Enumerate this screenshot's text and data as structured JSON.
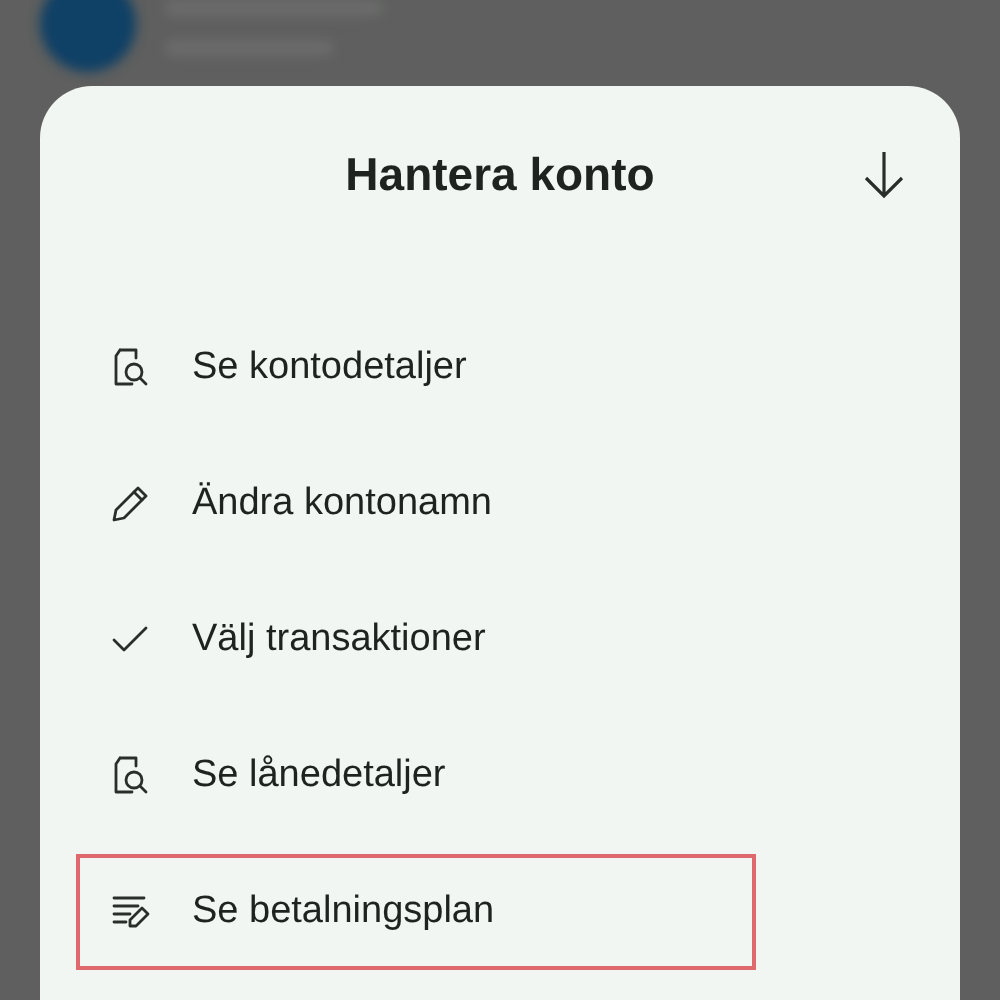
{
  "sheet": {
    "title": "Hantera konto",
    "items": [
      {
        "label": "Se kontodetaljer",
        "kind": "document",
        "selected": false
      },
      {
        "label": "Ändra kontonamn",
        "kind": "pencil",
        "selected": false
      },
      {
        "label": "Välj transaktioner",
        "kind": "check",
        "selected": false
      },
      {
        "label": "Se lånedetaljer",
        "kind": "document",
        "selected": false
      },
      {
        "label": "Se betalningsplan",
        "kind": "plan",
        "selected": true
      }
    ]
  }
}
